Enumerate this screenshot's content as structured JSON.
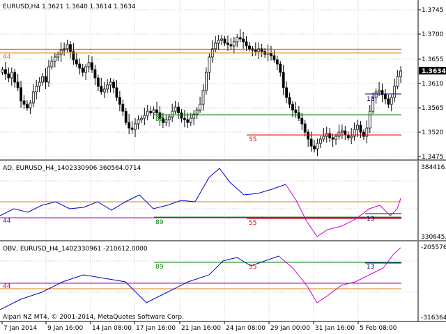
{
  "panels": {
    "main": {
      "header": "EURUSD,H4  1.3621 1.3640 1.3614 1.3634",
      "price_ticks": [
        "1.3745",
        "1.3700",
        "1.3655",
        "1.3610",
        "1.3565",
        "1.3520",
        "1.3475"
      ],
      "current_price": "1.3634",
      "level_labels": {
        "l44": "44",
        "l89": "89",
        "l55": "55",
        "l13": "13"
      }
    },
    "ad": {
      "header": "AD, EURUSD_H4_1402330906 360564.0714",
      "scale_top": "384416.1",
      "scale_bottom": "330645.8",
      "level_labels": {
        "l44": "44",
        "l89": "89",
        "l55": "55",
        "l13": "13"
      }
    },
    "obv": {
      "header": "OBV, EURUSD_H4_1402330961 -210612.0000",
      "scale_top": "-205576.",
      "scale_bottom": "-316364.",
      "level_labels": {
        "l89": "89",
        "l55": "55",
        "l44": "44",
        "l13": "13"
      }
    }
  },
  "time_axis": [
    "7 Jan 2014",
    "9 Jan 16:00",
    "14 Jan 08:00",
    "17 Jan 16:00",
    "21 Jan 16:00",
    "24 Jan 08:00",
    "29 Jan 00:00",
    "31 Jan 16:00",
    "5 Feb 08:00"
  ],
  "footer": "Alpari NZ MT4, © 2001-2014, MetaQuotes Software Corp.",
  "colors": {
    "level_orange": "#e08000",
    "level_red": "#e00000",
    "level_green": "#008000",
    "level_blue": "#000080",
    "level_purple": "#a000a0",
    "ad_up": "#0000cc",
    "ad_down": "#cc00cc",
    "grid": "#c8c8c8"
  }
}
